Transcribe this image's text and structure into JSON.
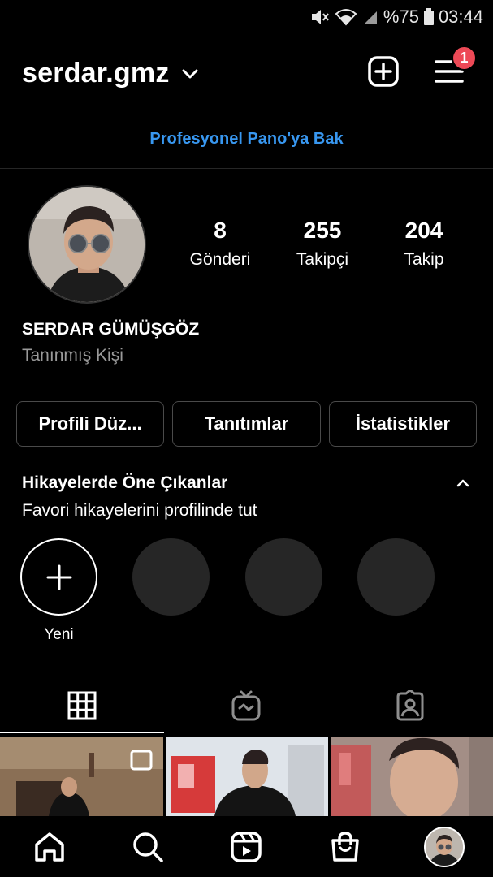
{
  "status_bar": {
    "battery": "%75",
    "time": "03:44"
  },
  "header": {
    "username": "serdar.gmz",
    "notification_count": "1"
  },
  "pro_dashboard": {
    "label": "Profesyonel Pano'ya Bak"
  },
  "profile": {
    "full_name": "SERDAR GÜMÜŞGÖZ",
    "category": "Tanınmış Kişi",
    "stats": [
      {
        "value": "8",
        "label": "Gönderi"
      },
      {
        "value": "255",
        "label": "Takipçi"
      },
      {
        "value": "204",
        "label": "Takip"
      }
    ]
  },
  "actions": {
    "edit_profile": "Profili Düz...",
    "promotions": "Tanıtımlar",
    "insights": "İstatistikler"
  },
  "highlights": {
    "title": "Hikayelerde Öne Çıkanlar",
    "subtitle": "Favori hikayelerini profilinde tut",
    "new_label": "Yeni"
  },
  "colors": {
    "link_blue": "#3897f0",
    "badge_red": "#ed4956",
    "placeholder_gray": "#262626"
  },
  "icons": {
    "header": [
      "chevron-down-icon",
      "new-post-icon",
      "menu-icon"
    ],
    "tabs": [
      "grid-icon",
      "igtv-icon",
      "tagged-icon"
    ],
    "bottom_nav": [
      "home-icon",
      "search-icon",
      "reels-icon",
      "shop-icon",
      "profile-avatar"
    ]
  }
}
